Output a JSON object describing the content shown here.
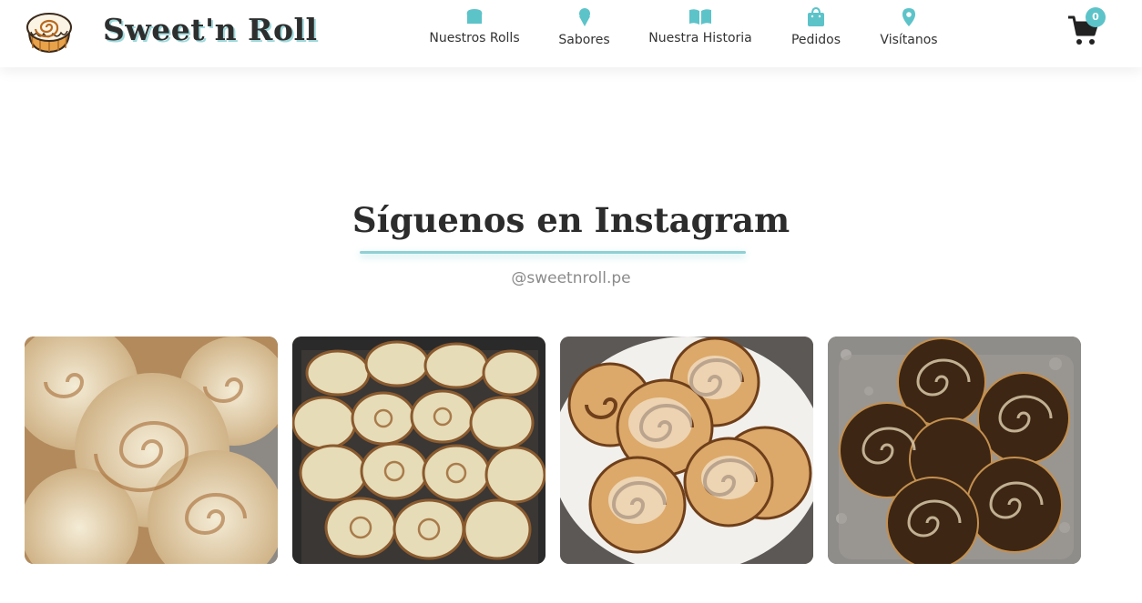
{
  "header": {
    "brand": "Sweet'n Roll",
    "logo_icon": "cinnamon-roll-icon",
    "nav": [
      {
        "label": "Nuestros Rolls",
        "icon": "bread-icon"
      },
      {
        "label": "Sabores",
        "icon": "ice-cream-icon"
      },
      {
        "label": "Nuestra Historia",
        "icon": "book-open-icon"
      },
      {
        "label": "Pedidos",
        "icon": "shopping-bag-icon"
      },
      {
        "label": "Visítanos",
        "icon": "map-marker-icon"
      }
    ],
    "cart": {
      "icon": "shopping-cart-icon",
      "count": "0"
    }
  },
  "instagram": {
    "title": "Síguenos en Instagram",
    "handle": "@sweetnroll.pe",
    "photos": [
      {
        "description": "cinnamon-rolls-closeup-icing"
      },
      {
        "description": "cinnamon-rolls-tray"
      },
      {
        "description": "cinnamon-rolls-plate"
      },
      {
        "description": "cinnamon-rolls-glass-dish"
      }
    ]
  },
  "colors": {
    "accent": "#5cc3c9",
    "text_dark": "#2c2c2c",
    "text_muted": "#8a8a8a",
    "header_bg": "#ffffff"
  }
}
